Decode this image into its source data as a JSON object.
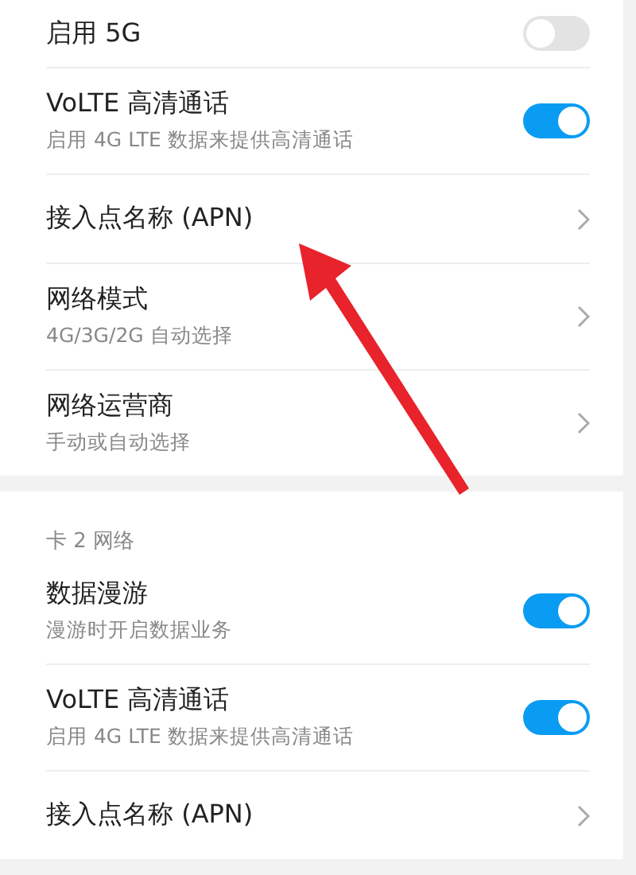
{
  "sections": [
    {
      "items": [
        {
          "kind": "toggle",
          "title": "启用 5G",
          "on": false
        },
        {
          "kind": "toggle",
          "title": "VoLTE 高清通话",
          "subtitle": "启用 4G LTE 数据来提供高清通话",
          "on": true
        },
        {
          "kind": "link",
          "title": "接入点名称 (APN)"
        },
        {
          "kind": "link",
          "title": "网络模式",
          "subtitle": "4G/3G/2G 自动选择"
        },
        {
          "kind": "link",
          "title": "网络运营商",
          "subtitle": "手动或自动选择"
        }
      ]
    },
    {
      "header": "卡 2 网络",
      "items": [
        {
          "kind": "toggle",
          "title": "数据漫游",
          "subtitle": "漫游时开启数据业务",
          "on": true
        },
        {
          "kind": "toggle",
          "title": "VoLTE 高清通话",
          "subtitle": "启用 4G LTE 数据来提供高清通话",
          "on": true
        },
        {
          "kind": "link",
          "title": "接入点名称 (APN)"
        }
      ]
    }
  ]
}
